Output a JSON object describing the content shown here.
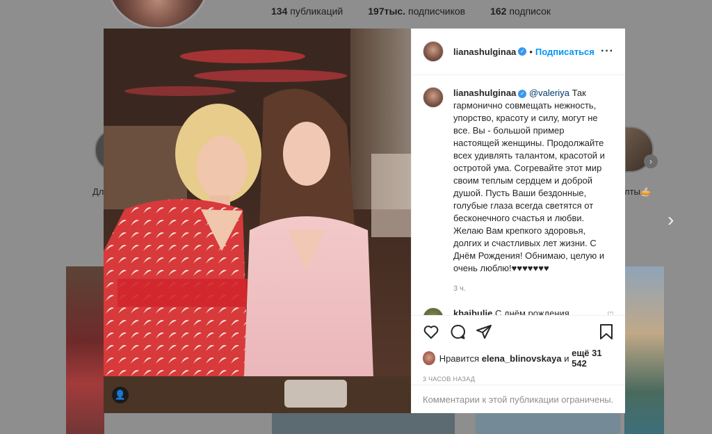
{
  "background": {
    "stats": [
      {
        "count": "134",
        "label": "публикаций"
      },
      {
        "count": "197тыс.",
        "label": "подписчиков"
      },
      {
        "count": "162",
        "label": "подписок"
      }
    ],
    "story_left_label": "Дл",
    "story_right_label": "лты🥧"
  },
  "post": {
    "username": "lianashulginaa",
    "follow_label": "Подписаться",
    "caption_username": "lianashulginaa",
    "caption_mention": "@valeriya",
    "caption_text": "Так гармонично совмещать нежность, упорство, красоту и силу, могут не все. Вы - большой пример настоящей женщины. Продолжайте всех удивлять талантом, красотой и остротой ума. Согревайте этот мир своим теплым сердцем и доброй душой. Пусть Ваши бездонные, голубые глаза всегда светятся от бесконечного счастья и любви. Желаю Вам крепкого здоровья, долгих и счастливых лет жизни. С Днём Рождения! Обнимаю, целую и очень люблю!♥♥♥♥♥♥♥",
    "caption_time": "3 ч.",
    "comment": {
      "username": "khaibulie",
      "text": "С днём рождения Великую артистку, просто"
    },
    "likes_prefix": "Нравится",
    "likes_user": "elena_blinovskaya",
    "likes_and": "и",
    "likes_rest": "ещё 31 542",
    "timestamp": "3 ЧАСОВ НАЗАД",
    "comments_restricted": "Комментарии к этой публикации ограничены."
  },
  "icons": {
    "more": "more-options-icon",
    "heart": "heart-icon",
    "comment": "comment-icon",
    "share": "share-icon",
    "bookmark": "bookmark-icon",
    "tag": "user-tag-icon",
    "next": "chevron-right-icon"
  },
  "colors": {
    "link": "#0095f6",
    "verified": "#3897f0",
    "muted": "#8e8e8e"
  }
}
